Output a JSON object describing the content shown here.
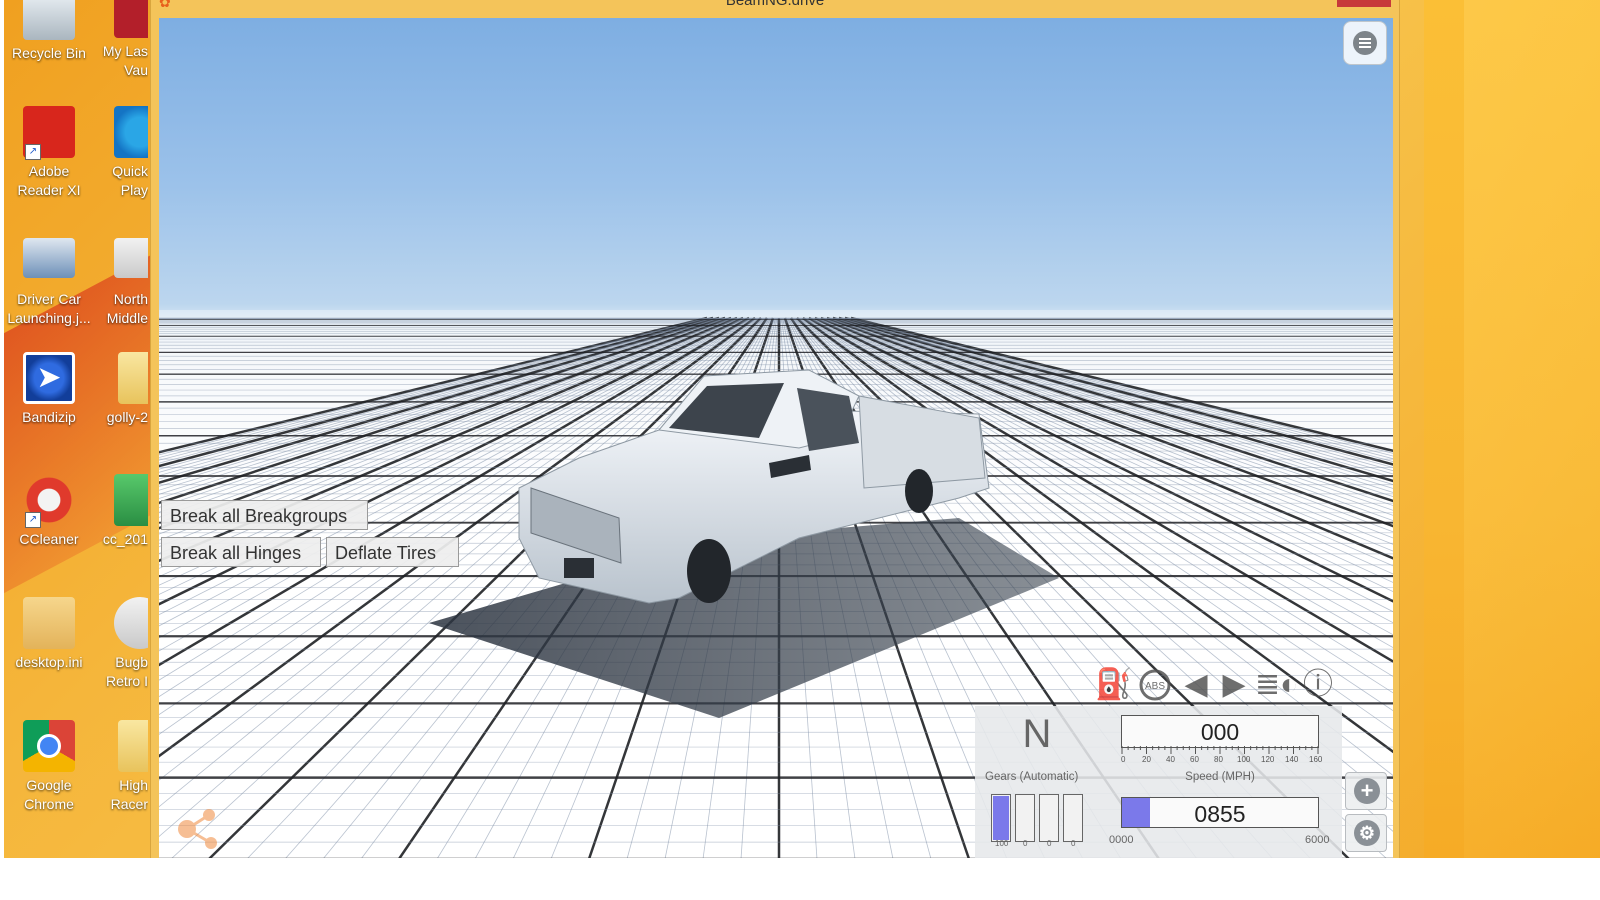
{
  "desktop": {
    "icons_col1": [
      {
        "label": "Recycle Bin",
        "icon": "recycle-bin-icon"
      },
      {
        "label": "Adobe Reader XI",
        "icon": "adobe-reader-icon"
      },
      {
        "label": "Driver Car Launching.j...",
        "icon": "image-file-icon"
      },
      {
        "label": "Bandizip",
        "icon": "bandizip-icon"
      },
      {
        "label": "CCleaner",
        "icon": "ccleaner-icon"
      },
      {
        "label": "desktop.ini",
        "icon": "settings-file-icon"
      },
      {
        "label": "Google Chrome",
        "icon": "chrome-icon"
      }
    ],
    "icons_col2": [
      {
        "label": "My Las Vau",
        "icon": "app-icon"
      },
      {
        "label": "Quick Play",
        "icon": "quickplay-icon"
      },
      {
        "label": "North Middle",
        "icon": "document-icon"
      },
      {
        "label": "golly-2",
        "icon": "folder-icon"
      },
      {
        "label": "cc_201",
        "icon": "archive-icon"
      },
      {
        "label": "Bugb Retro I",
        "icon": "game-icon"
      },
      {
        "label": "High Racer",
        "icon": "folder-icon"
      }
    ]
  },
  "window": {
    "title": "BeamNG.drive"
  },
  "breakgroup_panel": {
    "break_all_breakgroups": "Break all Breakgroups",
    "break_all_hinges": "Break all Hinges",
    "deflate_tires": "Deflate Tires"
  },
  "hud": {
    "indicator_icons": [
      "fuel-icon",
      "abs-icon",
      "left-turn-signal-icon",
      "right-turn-signal-icon",
      "headlight-icon",
      "warning-icon"
    ],
    "abs_text": "ABS",
    "gear": {
      "current": "N",
      "label": "Gears (Automatic)",
      "bar_values": [
        "100",
        "0",
        "0",
        "0"
      ],
      "bar_levels": [
        1.0,
        0,
        0,
        0
      ]
    },
    "speed": {
      "value": "000",
      "label": "Speed (MPH)",
      "scale": [
        "0",
        "20",
        "40",
        "60",
        "80",
        "100",
        "120",
        "140",
        "160"
      ]
    },
    "rpm": {
      "value": "0855",
      "min": "0000",
      "max": "6000",
      "fraction": 0.1425
    },
    "accent_color": "#7b79ea"
  }
}
